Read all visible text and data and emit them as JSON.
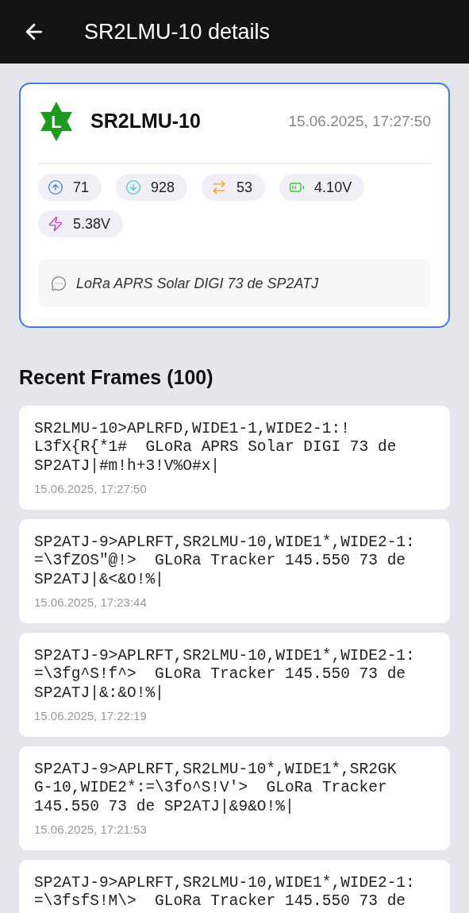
{
  "header": {
    "title": "SR2LMU-10 details"
  },
  "station": {
    "callsign": "SR2LMU-10",
    "timestamp": "15.06.2025, 17:27:50",
    "symbol": "L",
    "stats": [
      {
        "kind": "sent",
        "value": "71"
      },
      {
        "kind": "received",
        "value": "928"
      },
      {
        "kind": "relayed",
        "value": "53"
      },
      {
        "kind": "battery",
        "value": "4.10V"
      },
      {
        "kind": "power",
        "value": "5.38V"
      }
    ],
    "comment": "LoRa APRS Solar DIGI 73 de SP2ATJ"
  },
  "frames_section": {
    "title": "Recent Frames (100)",
    "frames": [
      {
        "lines": [
          "SR2LMU-10>APLRFD,WIDE1-1,WIDE2-1:!",
          "L3fX{R{*1#  GLoRa APRS Solar DIGI 73 de",
          "SP2ATJ|#m!h+3!V%O#x|"
        ],
        "time": "15.06.2025, 17:27:50"
      },
      {
        "lines": [
          "SP2ATJ-9>APLRFT,SR2LMU-10,WIDE1*,WIDE2-1:",
          "=\\3fZOS\"@!>  GLoRa Tracker 145.550 73 de",
          "SP2ATJ|&<&O!%|"
        ],
        "time": "15.06.2025, 17:23:44"
      },
      {
        "lines": [
          "SP2ATJ-9>APLRFT,SR2LMU-10,WIDE1*,WIDE2-1:",
          "=\\3fg^S!f^>  GLoRa Tracker 145.550 73 de",
          "SP2ATJ|&:&O!%|"
        ],
        "time": "15.06.2025, 17:22:19"
      },
      {
        "lines": [
          "SP2ATJ-9>APLRFT,SR2LMU-10*,WIDE1*,SR2GK",
          "G-10,WIDE2*:=\\3fo^S!V'>  GLoRa Tracker",
          "145.550 73 de SP2ATJ|&9&O!%|"
        ],
        "time": "15.06.2025, 17:21:53"
      },
      {
        "lines": [
          "SP2ATJ-9>APLRFT,SR2LMU-10,WIDE1*,WIDE2-1:",
          "=\\3fsfS!M\\>  GLoRa Tracker 145.550 73 de"
        ]
      }
    ]
  }
}
